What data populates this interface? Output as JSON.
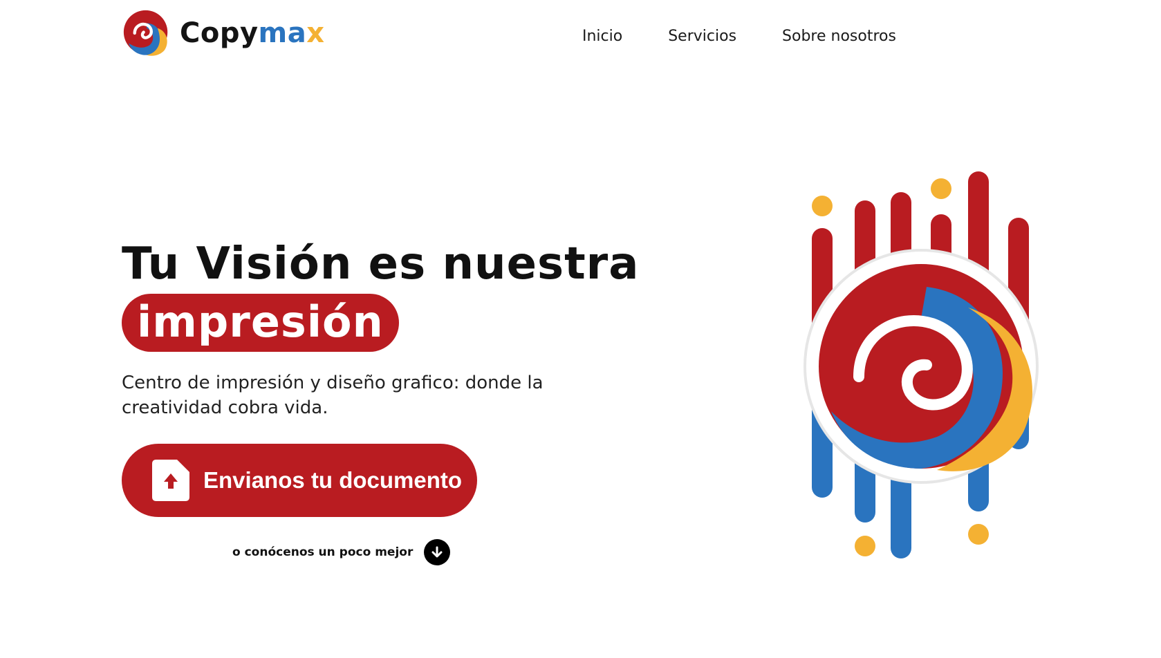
{
  "header": {
    "logo_icon": "copymax-swirl-logo",
    "brand": {
      "part1": "Copy",
      "part2": "ma",
      "part3": "x"
    },
    "nav": [
      {
        "label": "Inicio"
      },
      {
        "label": "Servicios"
      },
      {
        "label": "Sobre nosotros"
      }
    ]
  },
  "hero": {
    "headline": "Tu Visión es nuestra",
    "highlight": "impresión",
    "subtitle": "Centro de impresión y diseño grafico: donde la creatividad cobra vida.",
    "cta": {
      "label": "Envianos tu documento",
      "icon": "document-upload-icon"
    },
    "more": {
      "label": "o conócenos un poco mejor",
      "icon": "arrow-down-circle-icon"
    },
    "illustration_icon": "printer-swirl-illustration"
  },
  "colors": {
    "red": "#b91c21",
    "blue": "#2a74bf",
    "yellow": "#f4b133",
    "text": "#111111",
    "background": "#ffffff"
  }
}
